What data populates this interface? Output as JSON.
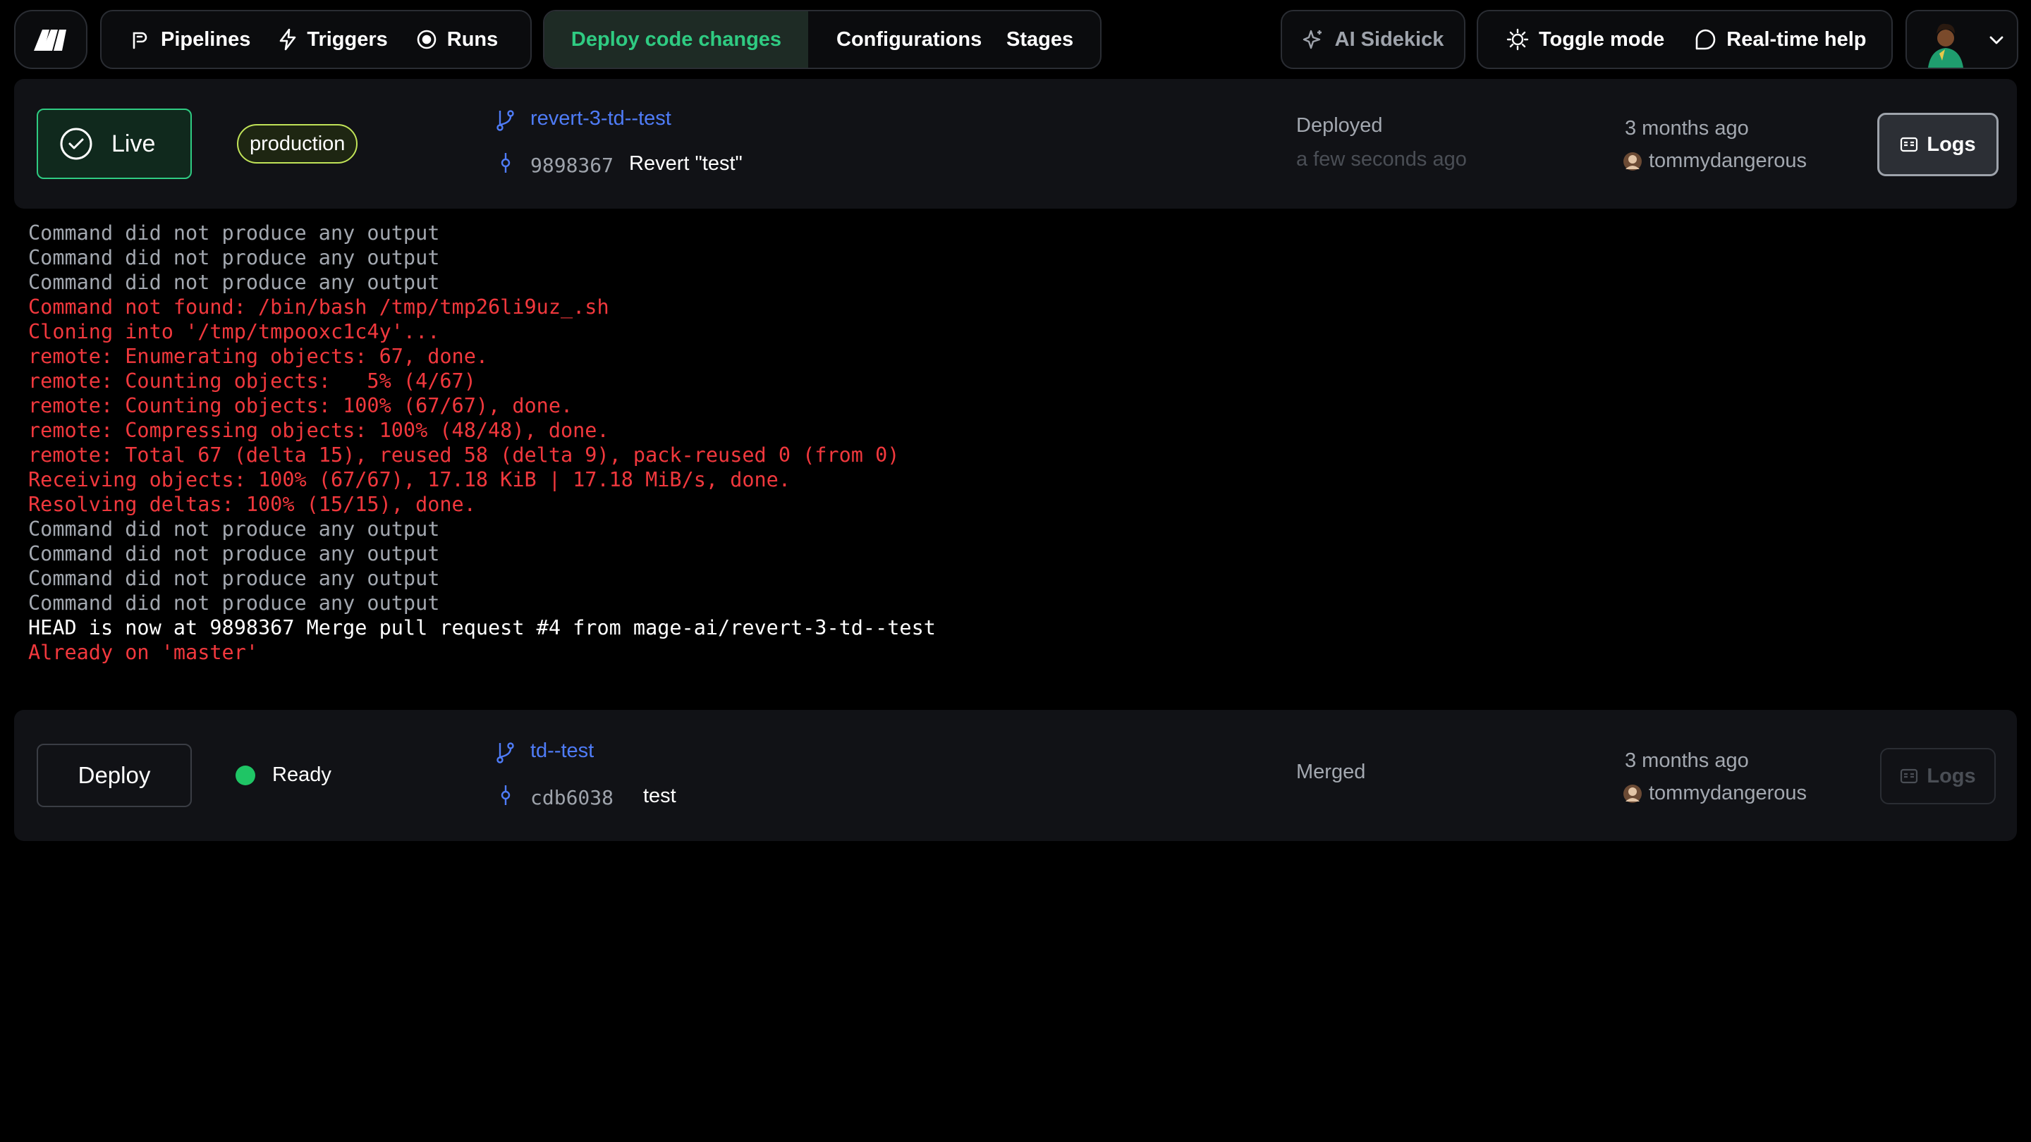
{
  "header": {
    "nav_left": [
      "Pipelines",
      "Triggers",
      "Runs"
    ],
    "tabs": [
      "Deploy code changes",
      "Configurations",
      "Stages"
    ],
    "ai_sidekick": "AI Sidekick",
    "toggle_mode": "Toggle mode",
    "realtime_help": "Real-time help"
  },
  "live_row": {
    "status": "Live",
    "env_badge": "production",
    "branch": "revert-3-td--test",
    "commit_sha": "9898367",
    "commit_message": "Revert \"test\"",
    "state": "Deployed",
    "state_time": "a few seconds ago",
    "time_ago": "3 months ago",
    "author": "tommydangerous",
    "logs_label": "Logs"
  },
  "log_lines": [
    {
      "text": "Command did not produce any output",
      "level": "gray"
    },
    {
      "text": "Command did not produce any output",
      "level": "gray"
    },
    {
      "text": "Command did not produce any output",
      "level": "gray"
    },
    {
      "text": "Command not found: /bin/bash /tmp/tmp26li9uz_.sh",
      "level": "red"
    },
    {
      "text": "Cloning into '/tmp/tmpooxc1c4y'...",
      "level": "red"
    },
    {
      "text": "remote: Enumerating objects: 67, done.",
      "level": "red"
    },
    {
      "text": "remote: Counting objects:   5% (4/67)",
      "level": "red"
    },
    {
      "text": "remote: Counting objects: 100% (67/67), done.",
      "level": "red"
    },
    {
      "text": "remote: Compressing objects: 100% (48/48), done.",
      "level": "red"
    },
    {
      "text": "remote: Total 67 (delta 15), reused 58 (delta 9), pack-reused 0 (from 0)",
      "level": "red"
    },
    {
      "text": "Receiving objects: 100% (67/67), 17.18 KiB | 17.18 MiB/s, done.",
      "level": "red"
    },
    {
      "text": "Resolving deltas: 100% (15/15), done.",
      "level": "red"
    },
    {
      "text": "Command did not produce any output",
      "level": "gray"
    },
    {
      "text": "Command did not produce any output",
      "level": "gray"
    },
    {
      "text": "Command did not produce any output",
      "level": "gray"
    },
    {
      "text": "Command did not produce any output",
      "level": "gray"
    },
    {
      "text": "HEAD is now at 9898367 Merge pull request #4 from mage-ai/revert-3-td--test",
      "level": "white"
    },
    {
      "text": "Already on 'master'",
      "level": "red"
    }
  ],
  "ready_row": {
    "deploy_label": "Deploy",
    "status": "Ready",
    "branch": "td--test",
    "commit_sha": "cdb6038",
    "commit_message": "test",
    "state": "Merged",
    "time_ago": "3 months ago",
    "author": "tommydangerous",
    "logs_label": "Logs"
  },
  "colors": {
    "accent_green": "#2fcb82",
    "link_blue": "#4f7cf7",
    "error_red": "#f1383d",
    "production_badge": "#c1e358",
    "ready_dot": "#1fc565"
  },
  "icons": [
    "mage-logo-icon",
    "pipelines-icon",
    "triggers-icon",
    "runs-icon",
    "ai-sidekick-icon",
    "toggle-mode-icon",
    "help-chat-icon",
    "chevron-down-icon",
    "check-circle-icon",
    "git-branch-icon",
    "git-commit-icon",
    "logs-icon"
  ]
}
